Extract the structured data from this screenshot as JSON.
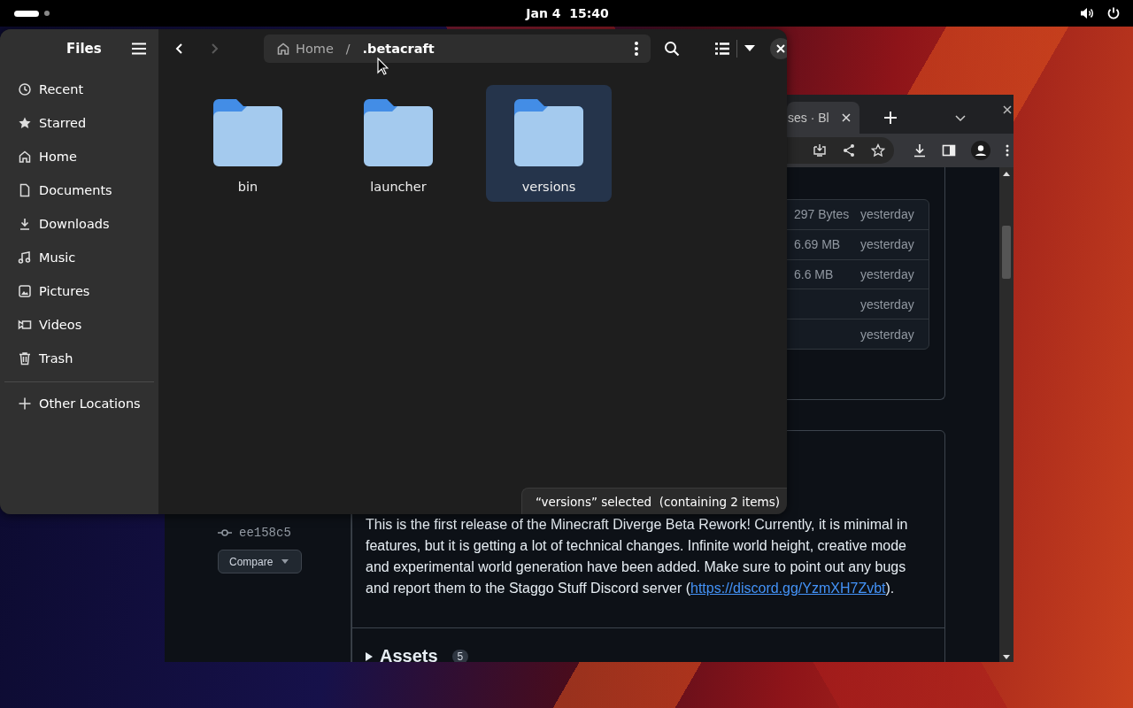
{
  "top_bar": {
    "clock": "Jan 4  15:40"
  },
  "files": {
    "title": "Files",
    "places": [
      {
        "kind": "recent",
        "label": "Recent"
      },
      {
        "kind": "starred",
        "label": "Starred"
      },
      {
        "kind": "home",
        "label": "Home"
      },
      {
        "kind": "documents",
        "label": "Documents"
      },
      {
        "kind": "downloads",
        "label": "Downloads"
      },
      {
        "kind": "music",
        "label": "Music"
      },
      {
        "kind": "pictures",
        "label": "Pictures"
      },
      {
        "kind": "videos",
        "label": "Videos"
      },
      {
        "kind": "trash",
        "label": "Trash"
      }
    ],
    "other_locations": "Other Locations",
    "nav": [
      {
        "kind": "back",
        "disabled": false
      },
      {
        "kind": "forward",
        "disabled": true
      }
    ],
    "path": [
      {
        "kind": "home",
        "label": "Home"
      },
      {
        "kind": "separator",
        "label": "/"
      },
      {
        "kind": "current",
        "label": ".betacraft"
      }
    ],
    "items": [
      {
        "name": "bin",
        "selected": false
      },
      {
        "name": "launcher",
        "selected": false
      },
      {
        "name": "versions",
        "selected": true
      }
    ],
    "status": "“versions” selected  (containing 2 items)"
  },
  "browser": {
    "tab": {
      "title": "ses · Bl"
    },
    "assets_table": [
      {
        "size": "297 Bytes",
        "date": "yesterday"
      },
      {
        "size": "6.69 MB",
        "date": "yesterday"
      },
      {
        "size": "6.6 MB",
        "date": "yesterday"
      },
      {
        "date": "yesterday"
      },
      {
        "date": "yesterday"
      }
    ],
    "commit": "ee158c5",
    "compare": "Compare",
    "body_before": "This is the first release of the Minecraft Diverge Beta Rework! Currently, it is minimal in features, but it is getting a lot of technical changes. Infinite world height, creative mode and experimental world generation have been added. Make sure to point out any bugs and report them to the Staggo Stuff Discord server (",
    "link": "https://discord.gg/YzmXH7Zvbt",
    "body_after": ").",
    "assets": {
      "label": "Assets",
      "count": "5"
    }
  }
}
